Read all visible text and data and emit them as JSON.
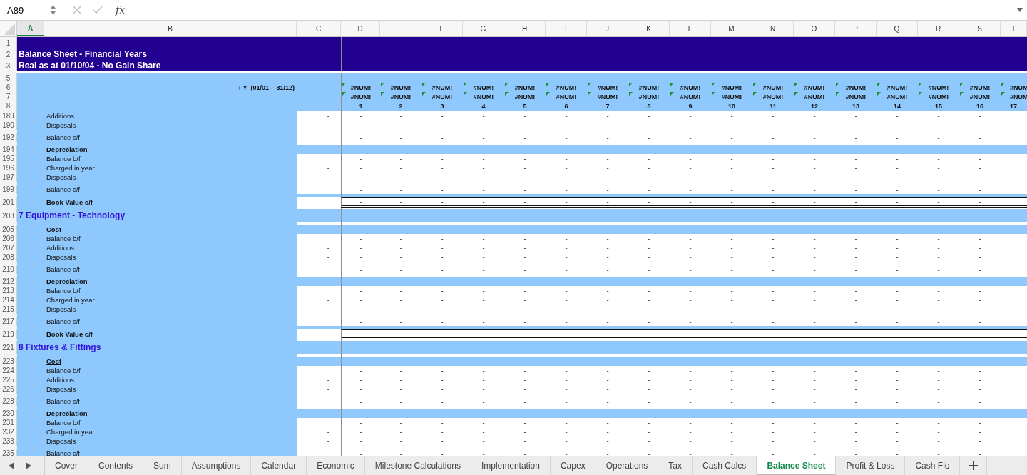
{
  "formula_bar": {
    "name_box": "A89",
    "function_label": "fx"
  },
  "column_headers": [
    {
      "letter": "A",
      "selected": true
    },
    {
      "letter": "B",
      "selected": false
    },
    {
      "letter": "C",
      "selected": false
    },
    {
      "letter": "D",
      "selected": false
    },
    {
      "letter": "E",
      "selected": false
    },
    {
      "letter": "F",
      "selected": false
    },
    {
      "letter": "G",
      "selected": false
    },
    {
      "letter": "H",
      "selected": false
    },
    {
      "letter": "I",
      "selected": false
    },
    {
      "letter": "J",
      "selected": false
    },
    {
      "letter": "K",
      "selected": false
    },
    {
      "letter": "L",
      "selected": false
    },
    {
      "letter": "M",
      "selected": false
    },
    {
      "letter": "N",
      "selected": false
    },
    {
      "letter": "O",
      "selected": false
    },
    {
      "letter": "P",
      "selected": false
    },
    {
      "letter": "Q",
      "selected": false
    },
    {
      "letter": "R",
      "selected": false
    },
    {
      "letter": "S",
      "selected": false
    },
    {
      "letter": "T",
      "selected": false
    }
  ],
  "title_rows": [
    {
      "num": "1"
    },
    {
      "num": "2",
      "text": "Balance Sheet - Financial Years"
    },
    {
      "num": "3",
      "text": "Real as at 01/10/04 - No Gain Share"
    }
  ],
  "period_rows": [
    {
      "num": "5"
    },
    {
      "num": "6",
      "text": "FY  (01/01 -  31/12)"
    },
    {
      "num": "7"
    },
    {
      "num": "8"
    }
  ],
  "year_columns": [
    {
      "line_1": "#NUM!",
      "line_2": "#NUM!",
      "index": "1",
      "flagged": true
    },
    {
      "line_1": "#NUM!",
      "line_2": "#NUM!",
      "index": "2",
      "flagged": true
    },
    {
      "line_1": "#NUM!",
      "line_2": "#NUM!",
      "index": "3",
      "flagged": true
    },
    {
      "line_1": "#NUM!",
      "line_2": "#NUM!",
      "index": "4",
      "flagged": true
    },
    {
      "line_1": "#NUM!",
      "line_2": "#NUM!",
      "index": "5",
      "flagged": true
    },
    {
      "line_1": "#NUM!",
      "line_2": "#NUM!",
      "index": "6",
      "flagged": true
    },
    {
      "line_1": "#NUM!",
      "line_2": "#NUM!",
      "index": "7",
      "flagged": true
    },
    {
      "line_1": "#NUM!",
      "line_2": "#NUM!",
      "index": "8",
      "flagged": true
    },
    {
      "line_1": "#NUM!",
      "line_2": "#NUM!",
      "index": "9",
      "flagged": true
    },
    {
      "line_1": "#NUM!",
      "line_2": "#NUM!",
      "index": "10",
      "flagged": true
    },
    {
      "line_1": "#NUM!",
      "line_2": "#NUM!",
      "index": "11",
      "flagged": true
    },
    {
      "line_1": "#NUM!",
      "line_2": "#NUM!",
      "index": "12",
      "flagged": true
    },
    {
      "line_1": "#NUM!",
      "line_2": "#NUM!",
      "index": "13",
      "flagged": true
    },
    {
      "line_1": "#NUM!",
      "line_2": "#NUM!",
      "index": "14",
      "flagged": true
    },
    {
      "line_1": "#NUM!",
      "line_2": "#NUM!",
      "index": "15",
      "flagged": true
    },
    {
      "line_1": "#NUM!",
      "line_2": "#NUM!",
      "index": "16",
      "flagged": true
    },
    {
      "line_1": "#NUM",
      "line_2": "#NUM",
      "index": "17",
      "flagged": true
    }
  ],
  "rows": [
    {
      "num": "189",
      "kind": "item",
      "label": "Additions",
      "c": "-",
      "values": [
        "-",
        "-",
        "-",
        "-",
        "-",
        "-",
        "-",
        "-",
        "-",
        "-",
        "-",
        "-",
        "-",
        "-",
        "-",
        "-"
      ]
    },
    {
      "num": "190",
      "kind": "item",
      "label": "Disposals",
      "c": "-",
      "values": [
        "-",
        "-",
        "-",
        "-",
        "-",
        "-",
        "-",
        "-",
        "-",
        "-",
        "-",
        "-",
        "-",
        "-",
        "-",
        "-"
      ]
    },
    {
      "num": "192",
      "kind": "total",
      "label": "Balance c/f",
      "values": [
        "-",
        "-",
        "-",
        "-",
        "-",
        "-",
        "-",
        "-",
        "-",
        "-",
        "-",
        "-",
        "-",
        "-",
        "-",
        "-"
      ]
    },
    {
      "num": "194",
      "kind": "heading",
      "label": "Depreciation"
    },
    {
      "num": "195",
      "kind": "item",
      "label": "Balance b/f",
      "values": [
        "-",
        "-",
        "-",
        "-",
        "-",
        "-",
        "-",
        "-",
        "-",
        "-",
        "-",
        "-",
        "-",
        "-",
        "-",
        "-"
      ]
    },
    {
      "num": "196",
      "kind": "item",
      "label": "Charged in year",
      "c": "-",
      "values": [
        "-",
        "-",
        "-",
        "-",
        "-",
        "-",
        "-",
        "-",
        "-",
        "-",
        "-",
        "-",
        "-",
        "-",
        "-",
        "-"
      ]
    },
    {
      "num": "197",
      "kind": "item",
      "label": "Disposals",
      "c": "-",
      "values": [
        "-",
        "-",
        "-",
        "-",
        "-",
        "-",
        "-",
        "-",
        "-",
        "-",
        "-",
        "-",
        "-",
        "-",
        "-",
        "-"
      ]
    },
    {
      "num": "199",
      "kind": "total",
      "label": "Balance c/f",
      "values": [
        "-",
        "-",
        "-",
        "-",
        "-",
        "-",
        "-",
        "-",
        "-",
        "-",
        "-",
        "-",
        "-",
        "-",
        "-",
        "-"
      ]
    },
    {
      "num": "201",
      "kind": "book",
      "label": "Book Value c/f",
      "values": [
        "-",
        "-",
        "-",
        "-",
        "-",
        "-",
        "-",
        "-",
        "-",
        "-",
        "-",
        "-",
        "-",
        "-",
        "-",
        "-"
      ]
    },
    {
      "num": "203",
      "kind": "section",
      "label": "7 Equipment - Technology"
    },
    {
      "num": "205",
      "kind": "heading",
      "label": "Cost"
    },
    {
      "num": "206",
      "kind": "item",
      "label": "Balance b/f",
      "values": [
        "-",
        "-",
        "-",
        "-",
        "-",
        "-",
        "-",
        "-",
        "-",
        "-",
        "-",
        "-",
        "-",
        "-",
        "-",
        "-"
      ]
    },
    {
      "num": "207",
      "kind": "item",
      "label": "Additions",
      "c": "-",
      "values": [
        "-",
        "-",
        "-",
        "-",
        "-",
        "-",
        "-",
        "-",
        "-",
        "-",
        "-",
        "-",
        "-",
        "-",
        "-",
        "-"
      ]
    },
    {
      "num": "208",
      "kind": "item",
      "label": "Disposals",
      "c": "-",
      "values": [
        "-",
        "-",
        "-",
        "-",
        "-",
        "-",
        "-",
        "-",
        "-",
        "-",
        "-",
        "-",
        "-",
        "-",
        "-",
        "-"
      ]
    },
    {
      "num": "210",
      "kind": "total",
      "label": "Balance c/f",
      "values": [
        "-",
        "-",
        "-",
        "-",
        "-",
        "-",
        "-",
        "-",
        "-",
        "-",
        "-",
        "-",
        "-",
        "-",
        "-",
        "-"
      ]
    },
    {
      "num": "212",
      "kind": "heading",
      "label": "Depreciation"
    },
    {
      "num": "213",
      "kind": "item",
      "label": "Balance b/f",
      "values": [
        "-",
        "-",
        "-",
        "-",
        "-",
        "-",
        "-",
        "-",
        "-",
        "-",
        "-",
        "-",
        "-",
        "-",
        "-",
        "-"
      ]
    },
    {
      "num": "214",
      "kind": "item",
      "label": "Charged in year",
      "c": "-",
      "values": [
        "-",
        "-",
        "-",
        "-",
        "-",
        "-",
        "-",
        "-",
        "-",
        "-",
        "-",
        "-",
        "-",
        "-",
        "-",
        "-"
      ]
    },
    {
      "num": "215",
      "kind": "item",
      "label": "Disposals",
      "c": "-",
      "values": [
        "-",
        "-",
        "-",
        "-",
        "-",
        "-",
        "-",
        "-",
        "-",
        "-",
        "-",
        "-",
        "-",
        "-",
        "-",
        "-"
      ]
    },
    {
      "num": "217",
      "kind": "total",
      "label": "Balance c/f",
      "values": [
        "-",
        "-",
        "-",
        "-",
        "-",
        "-",
        "-",
        "-",
        "-",
        "-",
        "-",
        "-",
        "-",
        "-",
        "-",
        "-"
      ]
    },
    {
      "num": "219",
      "kind": "book",
      "label": "Book Value c/f",
      "values": [
        "-",
        "-",
        "-",
        "-",
        "-",
        "-",
        "-",
        "-",
        "-",
        "-",
        "-",
        "-",
        "-",
        "-",
        "-",
        "-"
      ]
    },
    {
      "num": "221",
      "kind": "section",
      "label": "8 Fixtures & Fittings"
    },
    {
      "num": "223",
      "kind": "heading",
      "label": "Cost"
    },
    {
      "num": "224",
      "kind": "item",
      "label": "Balance b/f",
      "values": [
        "-",
        "-",
        "-",
        "-",
        "-",
        "-",
        "-",
        "-",
        "-",
        "-",
        "-",
        "-",
        "-",
        "-",
        "-",
        "-"
      ]
    },
    {
      "num": "225",
      "kind": "item",
      "label": "Additions",
      "c": "-",
      "values": [
        "-",
        "-",
        "-",
        "-",
        "-",
        "-",
        "-",
        "-",
        "-",
        "-",
        "-",
        "-",
        "-",
        "-",
        "-",
        "-"
      ]
    },
    {
      "num": "226",
      "kind": "item",
      "label": "Disposals",
      "c": "-",
      "values": [
        "-",
        "-",
        "-",
        "-",
        "-",
        "-",
        "-",
        "-",
        "-",
        "-",
        "-",
        "-",
        "-",
        "-",
        "-",
        "-"
      ]
    },
    {
      "num": "228",
      "kind": "total",
      "label": "Balance c/f",
      "values": [
        "-",
        "-",
        "-",
        "-",
        "-",
        "-",
        "-",
        "-",
        "-",
        "-",
        "-",
        "-",
        "-",
        "-",
        "-",
        "-"
      ]
    },
    {
      "num": "230",
      "kind": "heading",
      "label": "Depreciation"
    },
    {
      "num": "231",
      "kind": "item",
      "label": "Balance b/f",
      "values": [
        "-",
        "-",
        "-",
        "-",
        "-",
        "-",
        "-",
        "-",
        "-",
        "-",
        "-",
        "-",
        "-",
        "-",
        "-",
        "-"
      ]
    },
    {
      "num": "232",
      "kind": "item",
      "label": "Charged in year",
      "c": "-",
      "values": [
        "-",
        "-",
        "-",
        "-",
        "-",
        "-",
        "-",
        "-",
        "-",
        "-",
        "-",
        "-",
        "-",
        "-",
        "-",
        "-"
      ]
    },
    {
      "num": "233",
      "kind": "item",
      "label": "Disposals",
      "c": "-",
      "values": [
        "-",
        "-",
        "-",
        "-",
        "-",
        "-",
        "-",
        "-",
        "-",
        "-",
        "-",
        "-",
        "-",
        "-",
        "-",
        "-"
      ]
    },
    {
      "num": "235",
      "kind": "total",
      "label": "Balance c/f",
      "values": [
        "-",
        "-",
        "-",
        "-",
        "-",
        "-",
        "-",
        "-",
        "-",
        "-",
        "-",
        "-",
        "-",
        "-",
        "-",
        "-"
      ]
    }
  ],
  "sheet_tabs": [
    {
      "label": "Cover",
      "selected": false
    },
    {
      "label": "Contents",
      "selected": false
    },
    {
      "label": "Sum",
      "selected": false
    },
    {
      "label": "Assumptions",
      "selected": false
    },
    {
      "label": "Calendar",
      "selected": false
    },
    {
      "label": "Economic",
      "selected": false
    },
    {
      "label": "Milestone Calculations",
      "selected": false
    },
    {
      "label": "Implementation",
      "selected": false
    },
    {
      "label": "Capex",
      "selected": false
    },
    {
      "label": "Operations",
      "selected": false
    },
    {
      "label": "Tax",
      "selected": false
    },
    {
      "label": "Cash Calcs",
      "selected": false
    },
    {
      "label": "Balance Sheet",
      "selected": true
    },
    {
      "label": "Profit & Loss",
      "selected": false
    },
    {
      "label": "Cash Flo",
      "selected": false
    }
  ]
}
